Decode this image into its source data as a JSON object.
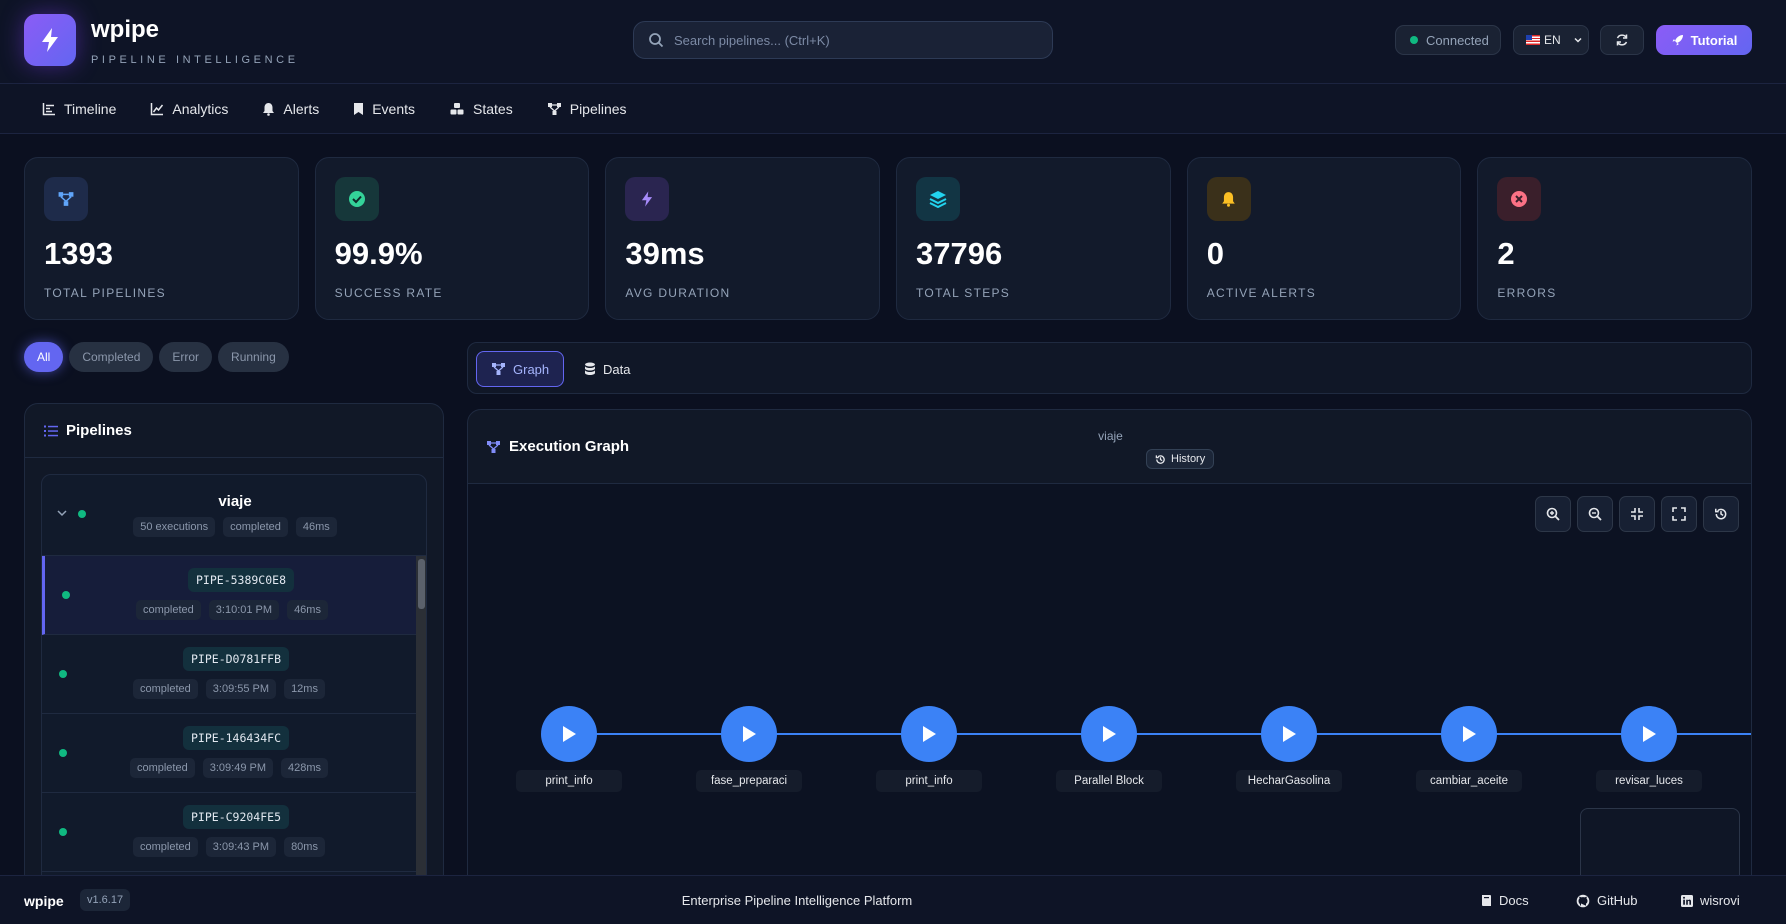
{
  "app": {
    "name": "wpipe",
    "subtitle": "PIPELINE INTELLIGENCE"
  },
  "search": {
    "placeholder": "Search pipelines... (Ctrl+K)"
  },
  "status": {
    "connection": "Connected",
    "language": "EN",
    "tutorial": "Tutorial"
  },
  "nav": [
    {
      "label": "Timeline",
      "icon": "timeline-icon"
    },
    {
      "label": "Analytics",
      "icon": "chart-line-icon"
    },
    {
      "label": "Alerts",
      "icon": "bell-icon"
    },
    {
      "label": "Events",
      "icon": "bookmark-icon"
    },
    {
      "label": "States",
      "icon": "cubes-icon"
    },
    {
      "label": "Pipelines",
      "icon": "sitemap-icon"
    }
  ],
  "stats": [
    {
      "value": "1393",
      "label": "TOTAL PIPELINES",
      "icon": "sitemap-icon",
      "color": "#60a5fa",
      "bg": "#1e2b4a"
    },
    {
      "value": "99.9%",
      "label": "SUCCESS RATE",
      "icon": "check-circle-icon",
      "color": "#34d399",
      "bg": "#16373a"
    },
    {
      "value": "39ms",
      "label": "AVG DURATION",
      "icon": "bolt-icon",
      "color": "#a78bfa",
      "bg": "#2a2550"
    },
    {
      "value": "37796",
      "label": "TOTAL STEPS",
      "icon": "layers-icon",
      "color": "#22d3ee",
      "bg": "#123544"
    },
    {
      "value": "0",
      "label": "ACTIVE ALERTS",
      "icon": "bell-icon",
      "color": "#fbbf24",
      "bg": "#3a301a"
    },
    {
      "value": "2",
      "label": "ERRORS",
      "icon": "x-circle-icon",
      "color": "#fb7185",
      "bg": "#3a1f2b"
    }
  ],
  "filters": [
    "All",
    "Completed",
    "Error",
    "Running"
  ],
  "pipelines_panel": {
    "title": "Pipelines",
    "group": {
      "name": "viaje",
      "executions": "50 executions",
      "status": "completed",
      "duration": "46ms"
    },
    "runs": [
      {
        "id": "PIPE-5389C0E8",
        "status": "completed",
        "time": "3:10:01 PM",
        "duration": "46ms"
      },
      {
        "id": "PIPE-D0781FFB",
        "status": "completed",
        "time": "3:09:55 PM",
        "duration": "12ms"
      },
      {
        "id": "PIPE-146434FC",
        "status": "completed",
        "time": "3:09:49 PM",
        "duration": "428ms"
      },
      {
        "id": "PIPE-C9204FE5",
        "status": "completed",
        "time": "3:09:43 PM",
        "duration": "80ms"
      }
    ]
  },
  "tabs": {
    "graph": "Graph",
    "data": "Data"
  },
  "graph": {
    "title": "Execution Graph",
    "pipeline": "viaje",
    "history": "History",
    "nodes": [
      "print_info",
      "fase_preparaci",
      "print_info",
      "Parallel Block",
      "HecharGasolina",
      "cambiar_aceite",
      "revisar_luces"
    ]
  },
  "footer": {
    "brand": "wpipe",
    "version": "v1.6.17",
    "tagline": "Enterprise Pipeline Intelligence Platform",
    "links": {
      "docs": "Docs",
      "github": "GitHub",
      "author": "wisrovi"
    }
  },
  "colors": {
    "accent": "#6366f1",
    "node": "#3b82f6",
    "success": "#10b981"
  }
}
